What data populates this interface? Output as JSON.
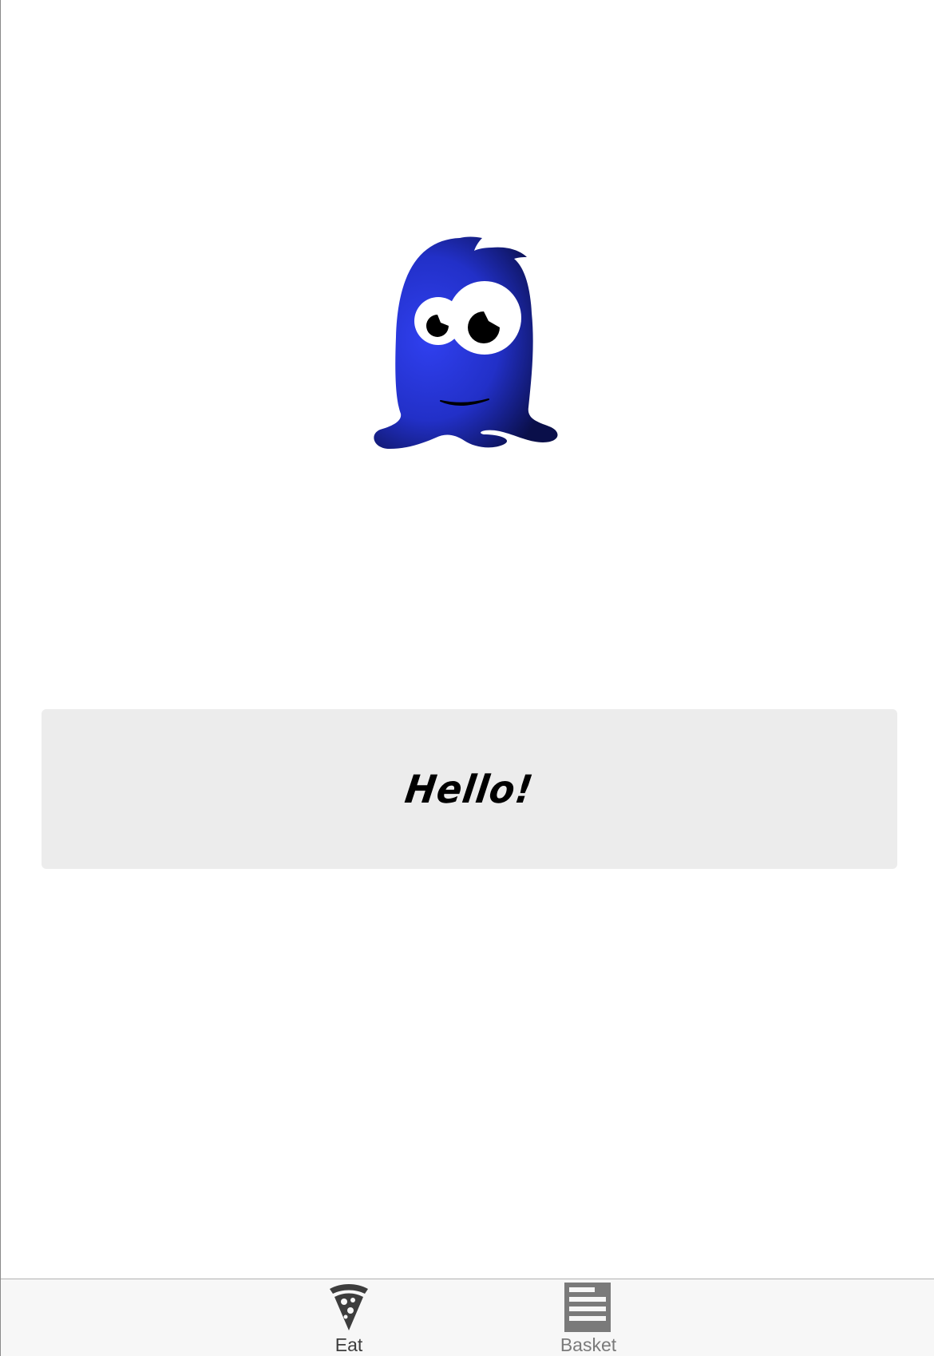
{
  "mascot": {
    "icon": "blue-blob-monster-icon",
    "body_color": "#2a35d8",
    "body_dark_color": "#0a0f4a"
  },
  "greeting": {
    "text": "Hello!",
    "card_color": "#ececec"
  },
  "tab_bar": {
    "tabs": [
      {
        "label": "Eat",
        "icon": "pizza-slice-icon",
        "selected": true
      },
      {
        "label": "Basket",
        "icon": "list-icon",
        "selected": false
      }
    ]
  }
}
